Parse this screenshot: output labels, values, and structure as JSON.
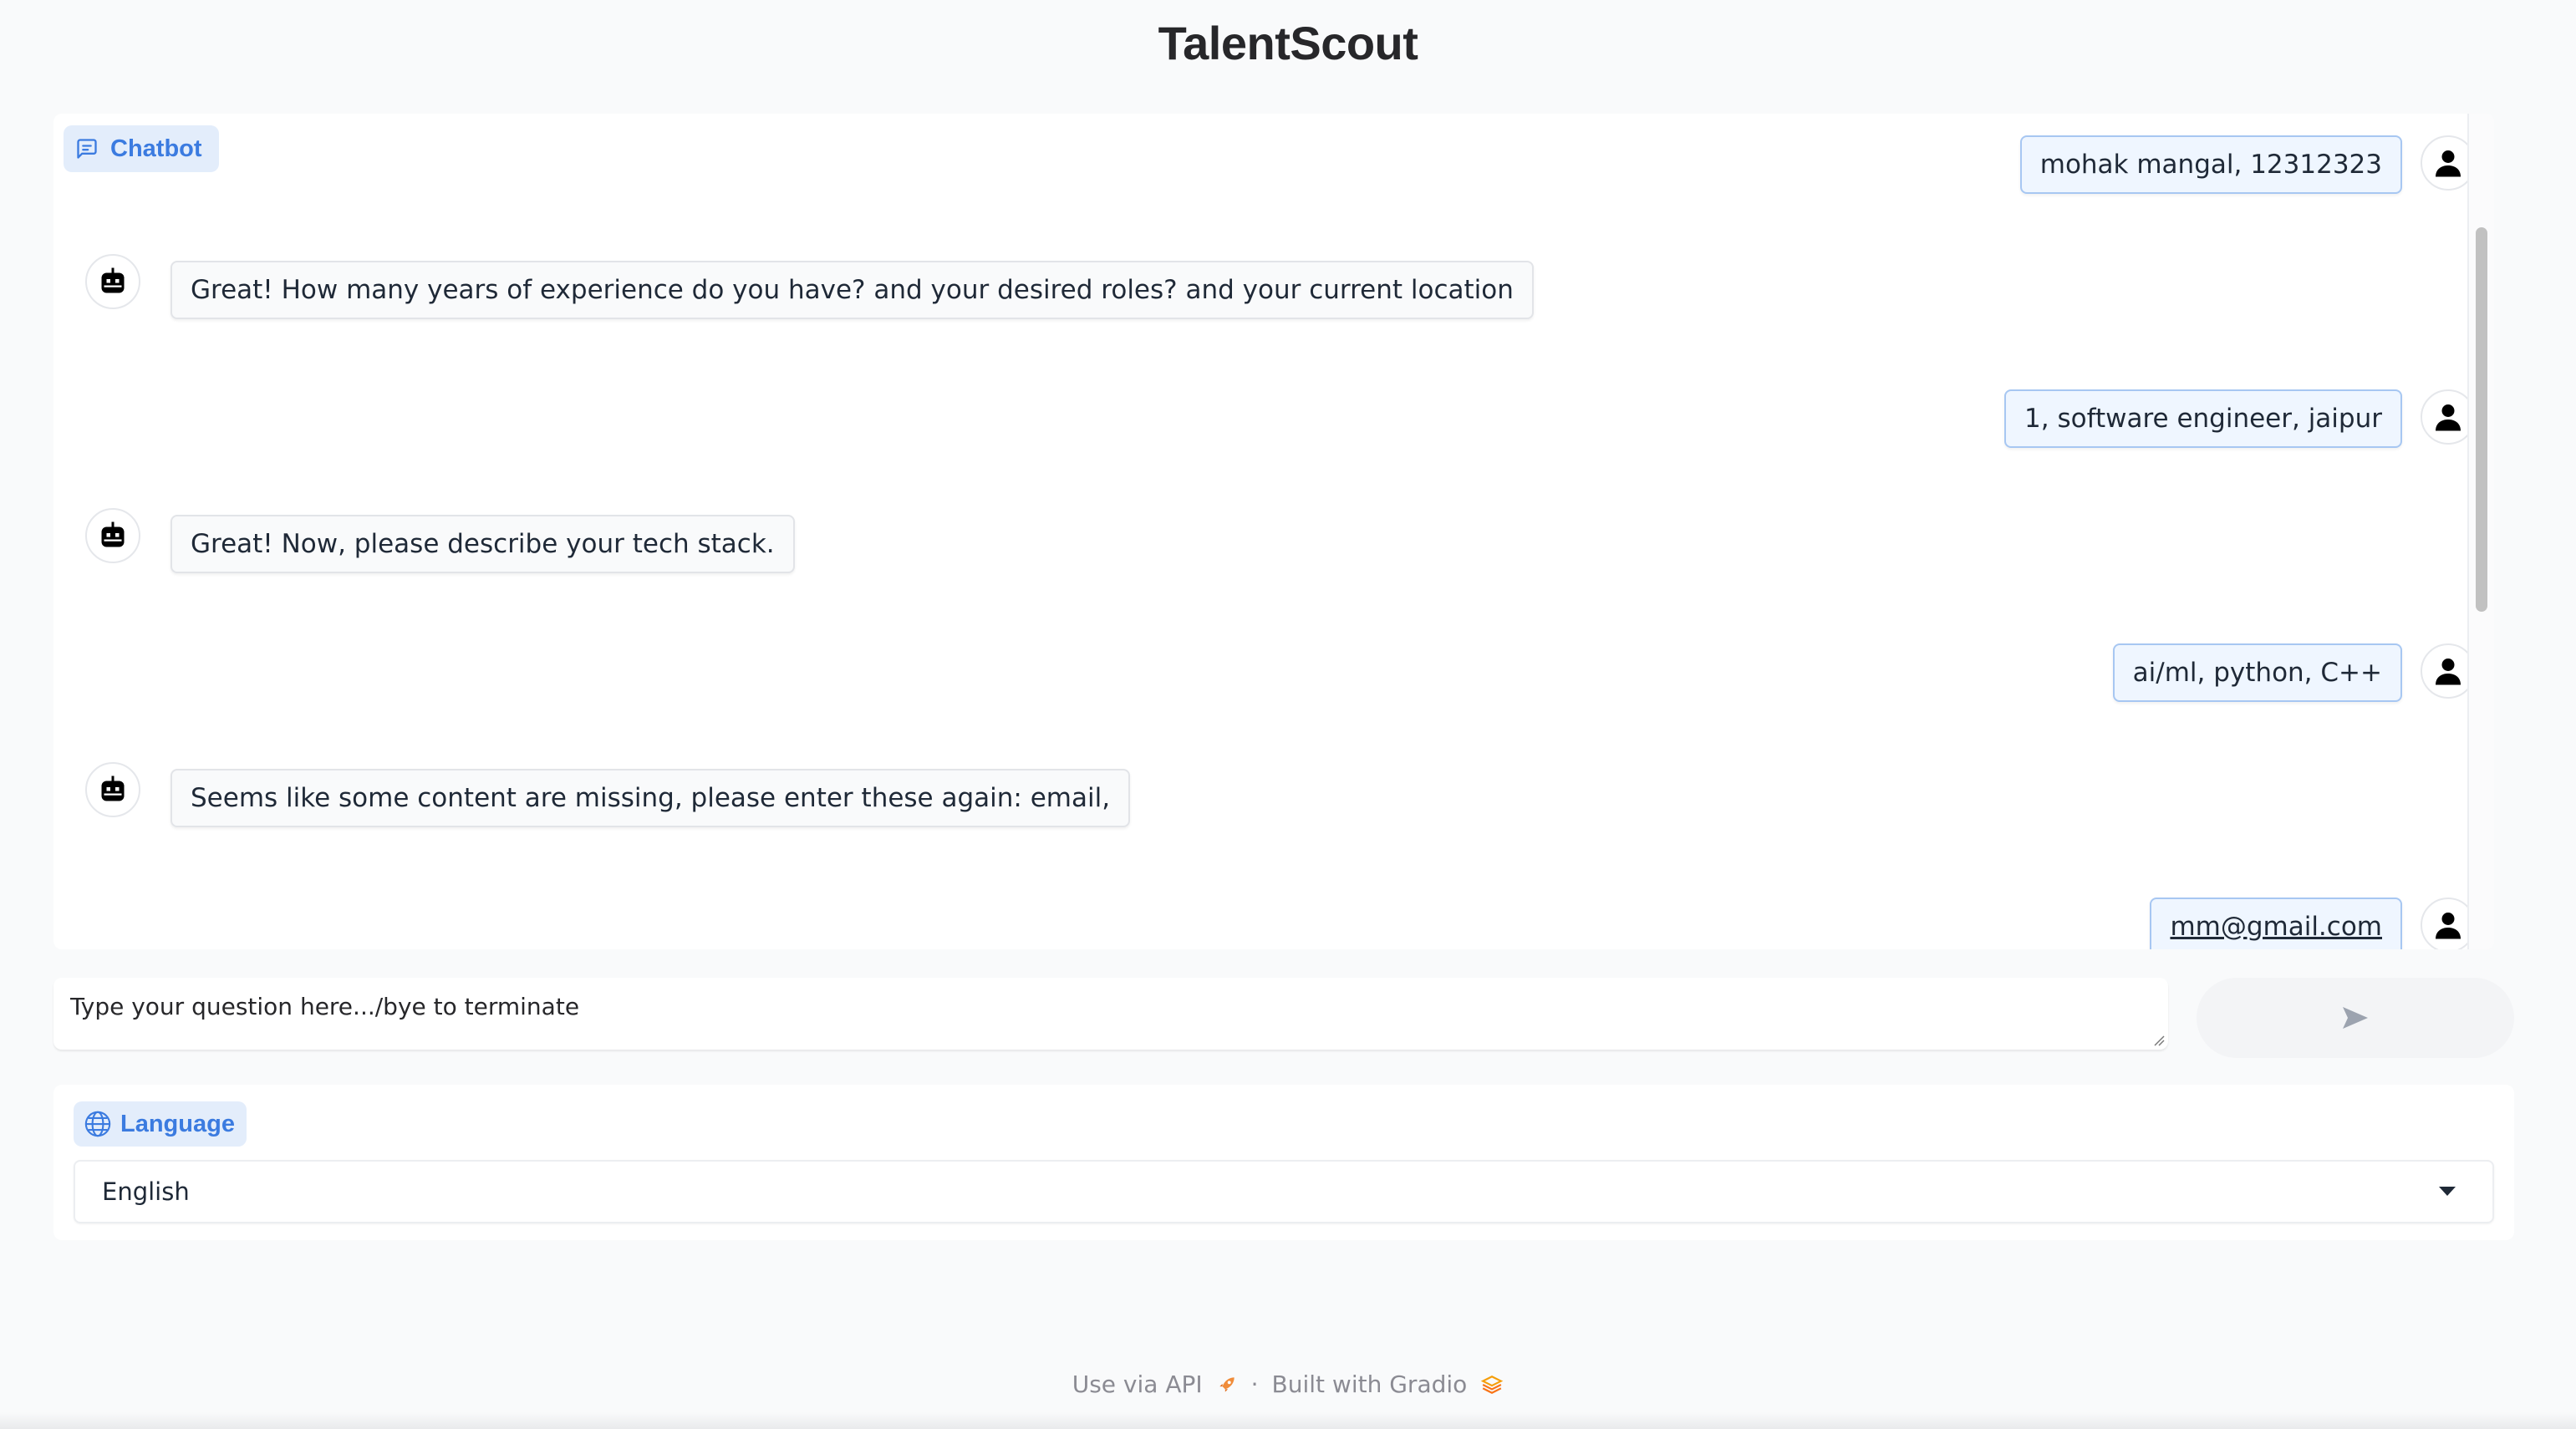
{
  "app": {
    "title": "TalentScout"
  },
  "chatbot": {
    "label": "Chatbot",
    "messages": [
      {
        "role": "user",
        "text": "mohak mangal, 12312323"
      },
      {
        "role": "bot",
        "text": "Great! How many years of experience do you have? and your desired roles? and your current location"
      },
      {
        "role": "user",
        "text": "1, software engineer, jaipur"
      },
      {
        "role": "bot",
        "text": "Great! Now, please describe your tech stack."
      },
      {
        "role": "user",
        "text": "ai/ml, python, C++"
      },
      {
        "role": "bot",
        "text": "Seems like some content are missing, please enter these again: email,"
      },
      {
        "role": "user",
        "text": "mm@gmail.com"
      }
    ],
    "icons": {
      "label": "chat-bubble-icon",
      "user_avatar": "user-icon",
      "bot_avatar": "robot-icon"
    }
  },
  "input": {
    "placeholder": "Type your question here.../bye to terminate",
    "send_icon": "send-arrow-icon"
  },
  "language": {
    "label": "Language",
    "icon": "globe-icon",
    "selected": "English"
  },
  "footer": {
    "api_text": "Use via API",
    "separator": "·",
    "built_text": "Built with Gradio"
  },
  "colors": {
    "accent": "#3b7be0",
    "label_bg": "#e3edfb",
    "user_bubble_bg": "#eff6ff",
    "user_bubble_border": "#a7c7f2",
    "page_bg": "#f9fafb"
  }
}
